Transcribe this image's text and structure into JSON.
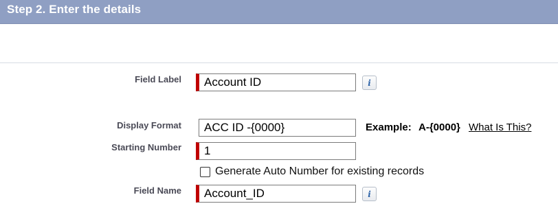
{
  "header": {
    "title": "Step 2. Enter the details"
  },
  "form": {
    "field_label": {
      "label": "Field Label",
      "value": "Account ID",
      "info": "i"
    },
    "display_format": {
      "label": "Display Format",
      "value": "ACC ID -{0000}",
      "example_label": "Example:",
      "example_value": "A-{0000}",
      "help_link": "What Is This?"
    },
    "starting_number": {
      "label": "Starting Number",
      "value": "1"
    },
    "generate_auto_number": {
      "label": "Generate Auto Number for existing records",
      "checked": false
    },
    "field_name": {
      "label": "Field Name",
      "value": "Account_ID",
      "info": "i"
    }
  },
  "colors": {
    "header_bg": "#8f9fc3",
    "required_marker": "#c00000",
    "label_text": "#4a4a56",
    "info_icon": "#2d63a8"
  }
}
